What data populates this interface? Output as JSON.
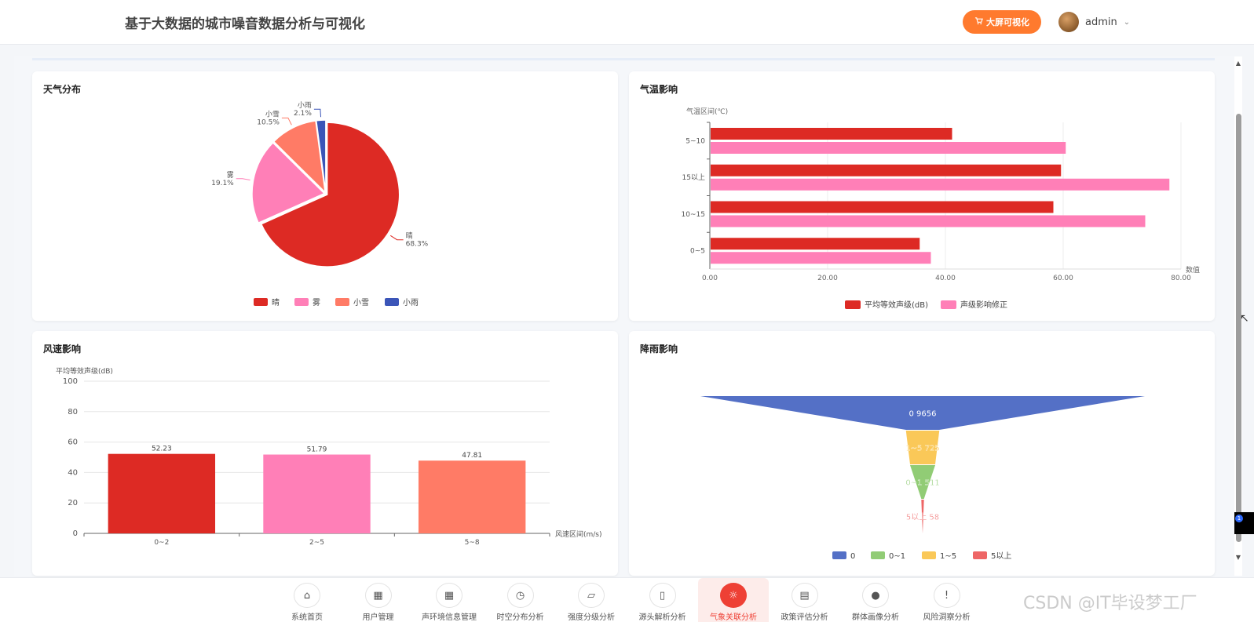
{
  "header": {
    "title": "基于大数据的城市噪音数据分析与可视化",
    "bigscreen_label": "大屏可视化",
    "username": "admin"
  },
  "weather_card": {
    "title": "天气分布"
  },
  "temp_card": {
    "title": "气温影响"
  },
  "wind_card": {
    "title": "风速影响"
  },
  "rain_card": {
    "title": "降雨影响"
  },
  "chart_data": [
    {
      "type": "pie",
      "slices": [
        {
          "label": "晴",
          "pct": "68.3%",
          "value": 68.3,
          "color": "#dd2a24"
        },
        {
          "label": "雾",
          "pct": "19.1%",
          "value": 19.1,
          "color": "#ff7fb7"
        },
        {
          "label": "小雪",
          "pct": "10.5%",
          "value": 10.5,
          "color": "#ff7b66"
        },
        {
          "label": "小雨",
          "pct": "2.1%",
          "value": 2.1,
          "color": "#3b55b8"
        }
      ],
      "legend": [
        "晴",
        "雾",
        "小雪",
        "小雨"
      ],
      "legend_position": "bottom"
    },
    {
      "type": "bar",
      "orientation": "horizontal",
      "categories": [
        "5~10",
        "15以上",
        "10~15",
        "0~5"
      ],
      "series": [
        {
          "name": "平均等效声级(dB)",
          "color": "#dd2a24",
          "values": [
            41,
            59.5,
            58.2,
            35.5
          ]
        },
        {
          "name": "声级影响修正",
          "color": "#ff7fb7",
          "values": [
            60.3,
            77.9,
            73.8,
            37.4
          ]
        }
      ],
      "ylabel": "气温区间(℃)",
      "xlabel": "数值",
      "xlim": [
        0,
        80
      ],
      "xticks": [
        "0.00",
        "20.00",
        "40.00",
        "60.00",
        "80.00"
      ],
      "legend_position": "bottom"
    },
    {
      "type": "bar",
      "categories": [
        "0~2",
        "2~5",
        "5~8"
      ],
      "values": [
        52.23,
        51.79,
        47.81
      ],
      "value_labels": [
        "52.23",
        "51.79",
        "47.81"
      ],
      "colors": [
        "#dd2a24",
        "#ff7fb7",
        "#ff7b66"
      ],
      "ylabel": "平均等效声级(dB)",
      "xlabel": "风速区间(m/s)",
      "ylim": [
        0,
        100
      ],
      "yticks": [
        "0",
        "20",
        "40",
        "60",
        "80",
        "100"
      ]
    },
    {
      "type": "funnel",
      "stages": [
        {
          "name": "0",
          "value": 9656,
          "label": "0 9656",
          "color": "#5470c6"
        },
        {
          "name": "1~5",
          "value": 725,
          "label": "1~5 725",
          "color": "#fac858"
        },
        {
          "name": "0~1",
          "value": 511,
          "label": "0~1 511",
          "color": "#91cc75"
        },
        {
          "name": "5以上",
          "value": 58,
          "label": "5以上 58",
          "color": "#ee6666"
        }
      ],
      "legend": [
        "0",
        "0~1",
        "1~5",
        "5以上"
      ],
      "legend_position": "bottom"
    }
  ],
  "nav": [
    {
      "label": "系统首页",
      "icon": "home-icon",
      "glyph": "⌂"
    },
    {
      "label": "用户管理",
      "icon": "grid-icon",
      "glyph": "▦"
    },
    {
      "label": "声环境信息管理",
      "icon": "grid-icon",
      "glyph": "▦"
    },
    {
      "label": "时空分布分析",
      "icon": "clock-icon",
      "glyph": "◷"
    },
    {
      "label": "强度分级分析",
      "icon": "presentation-icon",
      "glyph": "▱"
    },
    {
      "label": "源头解析分析",
      "icon": "book-icon",
      "glyph": "▯"
    },
    {
      "label": "气象关联分析",
      "icon": "sun-icon",
      "glyph": "☼",
      "active": true
    },
    {
      "label": "政策评估分析",
      "icon": "document-icon",
      "glyph": "▤"
    },
    {
      "label": "群体画像分析",
      "icon": "user-icon",
      "glyph": "●"
    },
    {
      "label": "风险洞察分析",
      "icon": "alert-icon",
      "glyph": "!"
    }
  ],
  "watermark": "CSDN @IT毕设梦工厂",
  "badge_count": "1"
}
